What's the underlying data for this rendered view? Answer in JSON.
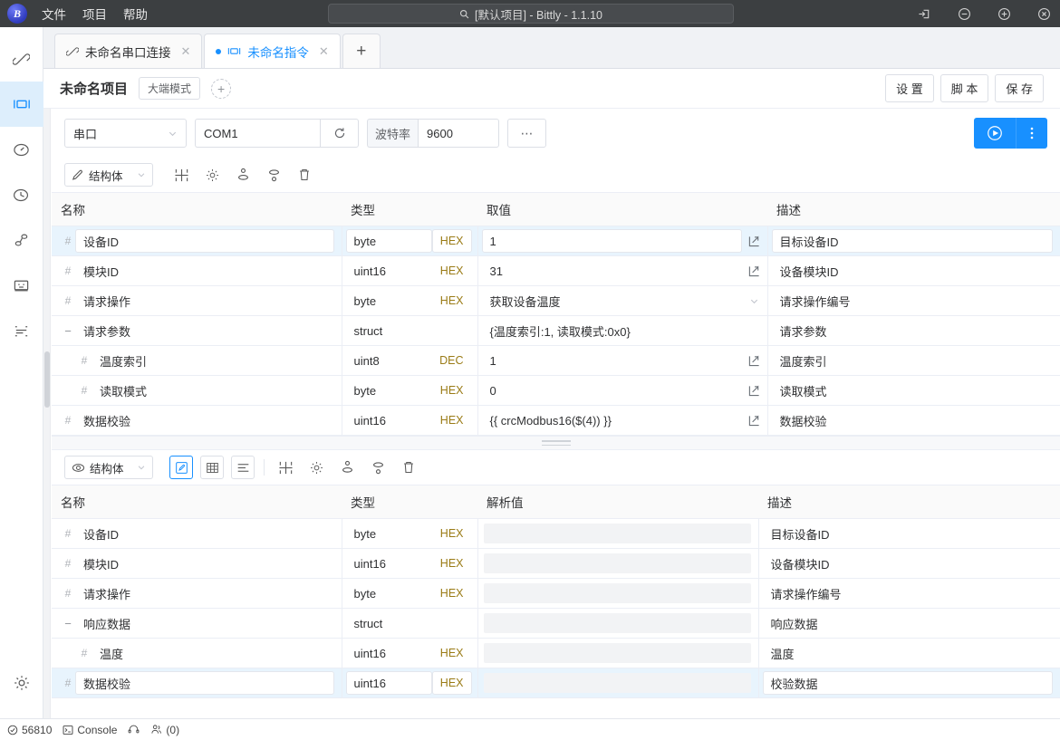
{
  "titlebar": {
    "logo_text": "B",
    "menu": [
      {
        "label": "文件",
        "name": "menu-file"
      },
      {
        "label": "项目",
        "name": "menu-project"
      },
      {
        "label": "帮助",
        "name": "menu-help"
      }
    ],
    "search_title": "[默认项目] - Bittly - 1.1.10",
    "controls": [
      {
        "name": "pin-icon"
      },
      {
        "name": "minimize-icon"
      },
      {
        "name": "maximize-icon"
      },
      {
        "name": "close-icon"
      }
    ]
  },
  "rail": {
    "items": [
      {
        "name": "sidebar-item-connections",
        "icon": "link-icon",
        "active": false
      },
      {
        "name": "sidebar-item-directives",
        "icon": "directive-icon",
        "active": true
      },
      {
        "name": "sidebar-item-dashboard",
        "icon": "gauge-icon",
        "active": false
      },
      {
        "name": "sidebar-item-history",
        "icon": "clock-icon",
        "active": false
      },
      {
        "name": "sidebar-item-flow",
        "icon": "nodes-icon",
        "active": false
      },
      {
        "name": "sidebar-item-panel",
        "icon": "window-icon",
        "active": false
      },
      {
        "name": "sidebar-item-logs",
        "icon": "lines-icon",
        "active": false
      }
    ],
    "settings": {
      "name": "sidebar-item-settings",
      "icon": "gear-icon"
    }
  },
  "tabs": [
    {
      "label": "未命名串口连接",
      "active": false,
      "icon": "link-icon",
      "close": "✕"
    },
    {
      "label": "未命名指令",
      "active": true,
      "icon": "directive-icon",
      "close": "✕"
    }
  ],
  "tab_add_label": "+",
  "project_header": {
    "title": "未命名项目",
    "badge": "大端模式",
    "add_label": "+",
    "buttons": [
      {
        "label": "设 置",
        "name": "settings-button"
      },
      {
        "label": "脚 本",
        "name": "script-button"
      },
      {
        "label": "保 存",
        "name": "save-button"
      }
    ]
  },
  "connection": {
    "type": "串口",
    "port_value": "COM1",
    "port_placeholder": "COM1",
    "baud_label": "波特率",
    "baud_value": "9600",
    "baud_placeholder": "9600",
    "more_label": "⋯",
    "run_icon": "play-circle-icon",
    "run_more_icon": "more-vertical-icon"
  },
  "request_panel": {
    "format_label": "结构体",
    "format_icon": "pencil-structure-icon",
    "toolbar_icons": [
      {
        "name": "expand-columns-icon"
      },
      {
        "name": "gear-icon"
      },
      {
        "name": "move-up-icon"
      },
      {
        "name": "move-down-icon"
      },
      {
        "name": "trash-icon"
      }
    ],
    "columns": [
      "名称",
      "类型",
      "取值",
      "描述"
    ],
    "rows": [
      {
        "name": "设备ID",
        "type": "byte",
        "endian": "HEX",
        "value": "1",
        "desc": "目标设备ID",
        "indent": 0,
        "marker": "#",
        "action": "expand",
        "highlight": true
      },
      {
        "name": "模块ID",
        "type": "uint16",
        "endian": "HEX",
        "value": "31",
        "desc": "设备模块ID",
        "indent": 0,
        "marker": "#",
        "action": "expand",
        "highlight": false
      },
      {
        "name": "请求操作",
        "type": "byte",
        "endian": "HEX",
        "value": "获取设备温度",
        "desc": "请求操作编号",
        "indent": 0,
        "marker": "#",
        "action": "caret",
        "highlight": false
      },
      {
        "name": "请求参数",
        "type": "struct",
        "endian": "",
        "value": "{温度索引:1, 读取模式:0x0}",
        "desc": "请求参数",
        "indent": 0,
        "marker": "−",
        "action": "none",
        "highlight": false
      },
      {
        "name": "温度索引",
        "type": "uint8",
        "endian": "DEC",
        "value": "1",
        "desc": "温度索引",
        "indent": 1,
        "marker": "#",
        "action": "expand",
        "highlight": false
      },
      {
        "name": "读取模式",
        "type": "byte",
        "endian": "HEX",
        "value": "0",
        "desc": "读取模式",
        "indent": 1,
        "marker": "#",
        "action": "expand",
        "highlight": false
      },
      {
        "name": "数据校验",
        "type": "uint16",
        "endian": "HEX",
        "value": "{{ crcModbus16($(4)) }}",
        "desc": "数据校验",
        "indent": 0,
        "marker": "#",
        "action": "expand",
        "highlight": false
      }
    ]
  },
  "response_panel": {
    "format_label": "结构体",
    "format_icon": "eye-structure-icon",
    "view_modes": [
      {
        "name": "view-mode-edit",
        "icon": "pencil-square-icon",
        "selected": true
      },
      {
        "name": "view-mode-table",
        "icon": "grid-icon",
        "selected": false
      },
      {
        "name": "view-mode-list",
        "icon": "list-icon",
        "selected": false
      }
    ],
    "toolbar_icons": [
      {
        "name": "expand-columns-icon"
      },
      {
        "name": "gear-icon"
      },
      {
        "name": "move-up-icon"
      },
      {
        "name": "move-down-icon"
      },
      {
        "name": "trash-icon"
      }
    ],
    "columns": [
      "名称",
      "类型",
      "解析值",
      "描述"
    ],
    "rows": [
      {
        "name": "设备ID",
        "type": "byte",
        "endian": "HEX",
        "value": "",
        "desc": "目标设备ID",
        "indent": 0,
        "marker": "#",
        "highlight": false
      },
      {
        "name": "模块ID",
        "type": "uint16",
        "endian": "HEX",
        "value": "",
        "desc": "设备模块ID",
        "indent": 0,
        "marker": "#",
        "highlight": false
      },
      {
        "name": "请求操作",
        "type": "byte",
        "endian": "HEX",
        "value": "",
        "desc": "请求操作编号",
        "indent": 0,
        "marker": "#",
        "highlight": false
      },
      {
        "name": "响应数据",
        "type": "struct",
        "endian": "",
        "value": "",
        "desc": "响应数据",
        "indent": 0,
        "marker": "−",
        "highlight": false
      },
      {
        "name": "温度",
        "type": "uint16",
        "endian": "HEX",
        "value": "",
        "desc": "温度",
        "indent": 1,
        "marker": "#",
        "highlight": false
      },
      {
        "name": "数据校验",
        "type": "uint16",
        "endian": "HEX",
        "value": "",
        "desc": "校验数据",
        "indent": 0,
        "marker": "#",
        "highlight": true
      }
    ]
  },
  "statusbar": {
    "port_number": "56810",
    "console_label": "Console",
    "users_label": "(0)"
  }
}
